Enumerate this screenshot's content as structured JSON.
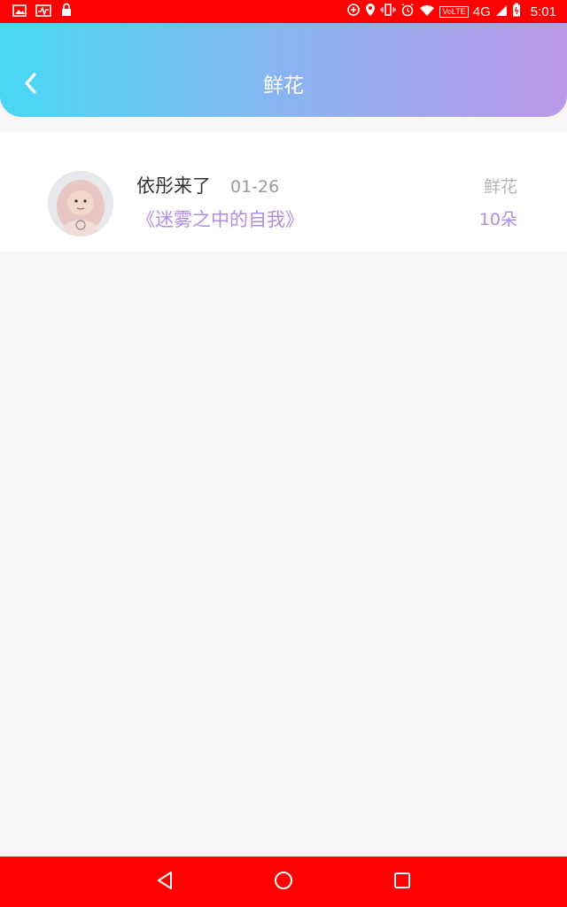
{
  "status_bar": {
    "network": "4G",
    "volte": "VoLTE",
    "time": "5:01",
    "color": "#ff0000",
    "icons_left": [
      "image-icon",
      "activity-icon",
      "lock-icon"
    ],
    "icons_right": [
      "data-saver-icon",
      "location-icon",
      "vibrate-icon",
      "alarm-icon",
      "wifi-icon",
      "signal-icon",
      "battery-icon"
    ]
  },
  "header": {
    "title": "鲜花",
    "back_icon": "chevron-left-icon",
    "gradient": [
      "#48d8f6",
      "#bc98e8"
    ]
  },
  "list": {
    "items": [
      {
        "user_name": "依彤来了",
        "date": "01-26",
        "book_title": "《迷雾之中的自我》",
        "gift_type": "鲜花",
        "gift_count": "10朵"
      }
    ]
  },
  "nav_bar": {
    "color": "#ff0000",
    "buttons": [
      "back-triangle-icon",
      "home-circle-icon",
      "recents-square-icon"
    ]
  }
}
